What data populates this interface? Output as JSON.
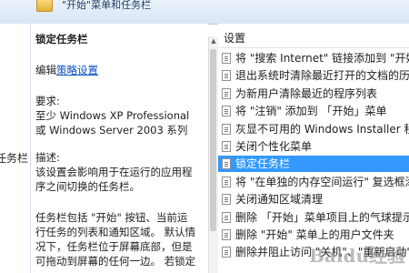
{
  "header": {
    "title": "\"开始\"菜单和任务栏"
  },
  "left_tree": {
    "item": "任务栏"
  },
  "description": {
    "title": "锁定任务栏",
    "edit_prefix": "编辑",
    "edit_link": "策略设置",
    "requirement_label": "要求:",
    "requirement_lines": [
      "至少 Windows XP Professional",
      "或 Windows Server 2003 系列"
    ],
    "description_label": "描述:",
    "paragraph1": [
      "该设置会影响用于在运行的应用程",
      "序之间切换的任务栏。"
    ],
    "paragraph2": [
      "任务栏包括 \"开始\" 按钮、当前运",
      "行任务的列表和通知区域。 默认情",
      "况下，任务栏位于屏幕底部，但是",
      "可拖动到屏幕的任何一边。 若锁定"
    ]
  },
  "settings": {
    "column_header": "设置",
    "items": [
      {
        "label": "将 \"搜索 Internet\" 链接添加到 \"开始",
        "selected": false
      },
      {
        "label": "退出系统时清除最近打开的文档的历史",
        "selected": false
      },
      {
        "label": "为新用户清除最近的程序列表",
        "selected": false
      },
      {
        "label": "将 \"注销\" 添加到 「开始」菜单",
        "selected": false
      },
      {
        "label": "灰显不可用的 Windows Installer 程序",
        "selected": false
      },
      {
        "label": "关闭个性化菜单",
        "selected": false
      },
      {
        "label": "锁定任务栏",
        "selected": true
      },
      {
        "label": "将 \"在单独的内存空间运行\" 复选框添",
        "selected": false
      },
      {
        "label": "关闭通知区域清理",
        "selected": false
      },
      {
        "label": "删除 「开始」菜单项目上的气球提示",
        "selected": false
      },
      {
        "label": "删除 \"开始\" 菜单上的用户文件夹",
        "selected": false
      },
      {
        "label": "删除并阻止访问 \"关机\"、\"重新启动\"",
        "selected": false
      }
    ]
  },
  "watermark": {
    "text": "Baidu经验"
  },
  "colors": {
    "selection": "#3399ff",
    "link": "#0a55c4",
    "header_bg": "#dde9f7"
  }
}
